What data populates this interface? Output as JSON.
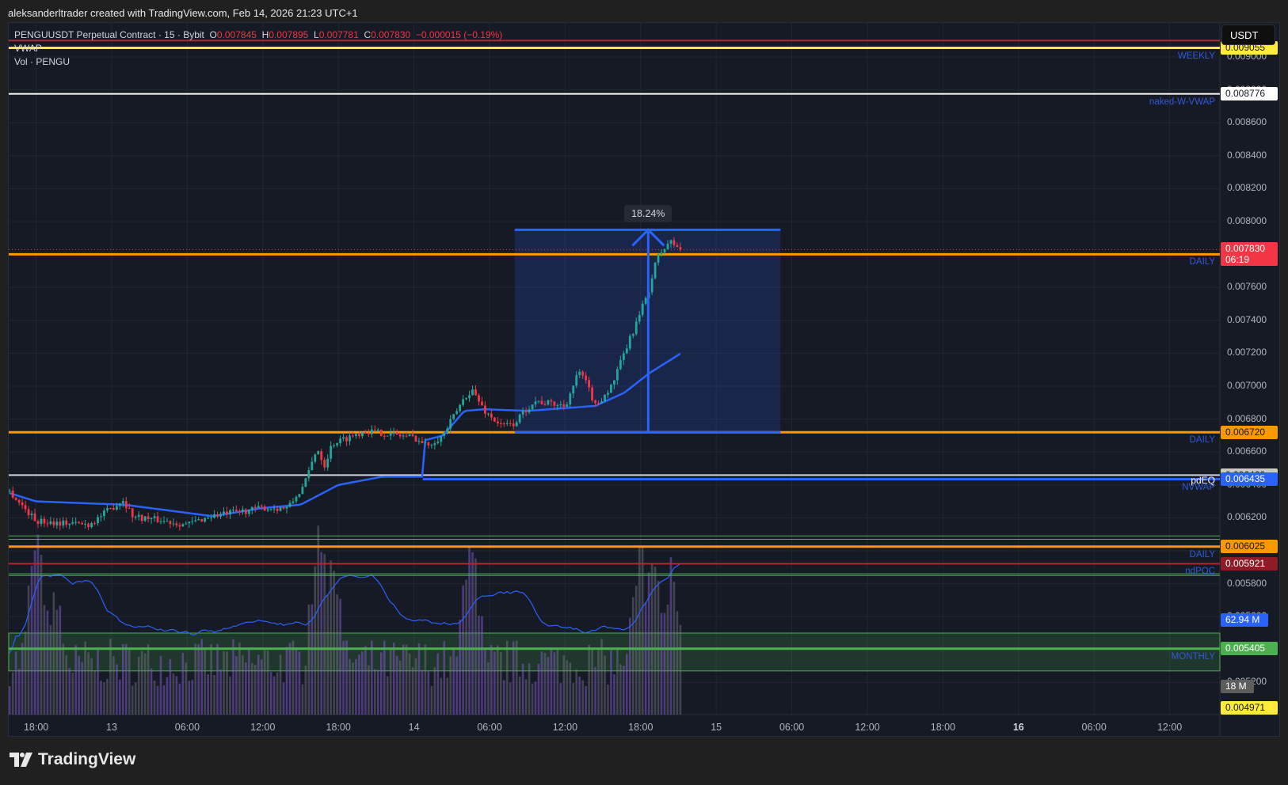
{
  "credit": "aleksanderltrader created with TradingView.com, Feb 14, 2026 21:23 UTC+1",
  "legend": {
    "symbol": "PENGUUSDT Perpetual Contract · 15 · Bybit",
    "o_label": "O",
    "o": "0.007845",
    "h_label": "H",
    "h": "0.007895",
    "l_label": "L",
    "l": "0.007781",
    "c_label": "C",
    "c": "0.007830",
    "change": "−0.000015 (−0.19%)",
    "vwap": "VWAP",
    "vol": "Vol · PENGU"
  },
  "currency": "USDT",
  "logo_text": "TradingView",
  "colors": {
    "up": "#26a69a",
    "down": "#f23645",
    "orange": "#ff9800",
    "blue": "#2962ff",
    "yellow": "#ffeb3b",
    "green": "#4caf50",
    "red": "#b22833",
    "bg": "#161a25"
  },
  "chart_data": {
    "type": "candlestick",
    "title": "PENGUUSDT Perpetual Contract · 15 · Bybit",
    "time_unit": "hours since Feb 12 18:00",
    "ylim": [
      0.00497,
      0.00914
    ],
    "y_ticks": [
      "0.009000",
      "0.008800",
      "0.008600",
      "0.008400",
      "0.008200",
      "0.008000",
      "0.007800",
      "0.007600",
      "0.007400",
      "0.007200",
      "0.007000",
      "0.006800",
      "0.006600",
      "0.006400",
      "0.006200",
      "0.006000",
      "0.005800",
      "0.005600",
      "0.005400",
      "0.005200"
    ],
    "x_ticks": [
      {
        "t": 0,
        "label": "18:00"
      },
      {
        "t": 6,
        "label": "13"
      },
      {
        "t": 12,
        "label": "06:00"
      },
      {
        "t": 18,
        "label": "12:00"
      },
      {
        "t": 24,
        "label": "18:00"
      },
      {
        "t": 30,
        "label": "14"
      },
      {
        "t": 36,
        "label": "06:00"
      },
      {
        "t": 42,
        "label": "12:00"
      },
      {
        "t": 48,
        "label": "18:00"
      },
      {
        "t": 54,
        "label": "15"
      },
      {
        "t": 60,
        "label": "06:00"
      },
      {
        "t": 66,
        "label": "12:00"
      },
      {
        "t": 72,
        "label": "18:00"
      },
      {
        "t": 78,
        "label": "16",
        "bold": true
      },
      {
        "t": 84,
        "label": "06:00"
      },
      {
        "t": 90,
        "label": "12:00"
      }
    ],
    "price_path": [
      [
        -2.1,
        0.00636
      ],
      [
        0,
        0.00618
      ],
      [
        4.2,
        0.00616
      ],
      [
        6.9,
        0.00631
      ],
      [
        7.7,
        0.00621
      ],
      [
        12,
        0.00616
      ],
      [
        13.8,
        0.00621
      ],
      [
        18,
        0.00626
      ],
      [
        20,
        0.00626
      ],
      [
        21.3,
        0.0064
      ],
      [
        22.3,
        0.00663
      ],
      [
        22.9,
        0.00652
      ],
      [
        23.5,
        0.00665
      ],
      [
        26.1,
        0.00673
      ],
      [
        30,
        0.00669
      ],
      [
        31,
        0.00664
      ],
      [
        32.3,
        0.0067
      ],
      [
        34,
        0.00693
      ],
      [
        34.6,
        0.00698
      ],
      [
        35.6,
        0.00685
      ],
      [
        36.9,
        0.00676
      ],
      [
        37.9,
        0.00677
      ],
      [
        39.5,
        0.00691
      ],
      [
        42,
        0.00688
      ],
      [
        43.1,
        0.00709
      ],
      [
        43.8,
        0.007
      ],
      [
        44.4,
        0.00688
      ],
      [
        45.7,
        0.007
      ],
      [
        46.7,
        0.0072
      ],
      [
        48,
        0.00745
      ],
      [
        48.7,
        0.0076
      ],
      [
        49.3,
        0.00778
      ],
      [
        50.3,
        0.00788
      ],
      [
        51.2,
        0.00783
      ]
    ],
    "vwap_path": [
      [
        -2.1,
        0.00635
      ],
      [
        0,
        0.0063
      ],
      [
        7,
        0.00628
      ],
      [
        14,
        0.00621
      ],
      [
        18,
        0.00626
      ],
      [
        21,
        0.00628
      ],
      [
        24,
        0.0064
      ],
      [
        27.5,
        0.00645
      ],
      [
        30.7,
        0.00645
      ],
      [
        30.8,
        0.00667
      ],
      [
        32.3,
        0.0067
      ],
      [
        34,
        0.00685
      ],
      [
        35.6,
        0.00686
      ],
      [
        39,
        0.00685
      ],
      [
        44.4,
        0.00688
      ],
      [
        46.7,
        0.00696
      ],
      [
        48.7,
        0.00708
      ],
      [
        51.2,
        0.0072
      ]
    ],
    "volume_spikes": [
      [
        0,
        0.9
      ],
      [
        1.5,
        0.6
      ],
      [
        22.5,
        0.9
      ],
      [
        23.5,
        0.75
      ],
      [
        34.5,
        0.9
      ],
      [
        48,
        0.8
      ],
      [
        49,
        0.75
      ],
      [
        50.5,
        0.7
      ]
    ],
    "levels": [
      {
        "price": 0.0091,
        "color": "#b22833",
        "width": 2,
        "tag": "",
        "label": ""
      },
      {
        "price": 0.009055,
        "color": "#ffeb3b",
        "width": 3,
        "tag": "WEEKLY",
        "label": "0.009055",
        "label_bg": "#ffeb3b",
        "label_fg": "#131722"
      },
      {
        "price": 0.008776,
        "color": "#ffffff",
        "width": 2,
        "tag": "naked-W-VWAP",
        "label": "0.008776",
        "label_bg": "#ffffff",
        "label_fg": "#131722"
      },
      {
        "price": 0.007801,
        "color": "#ff9800",
        "width": 3,
        "tag": "DAILY",
        "label": "0.007801",
        "label_bg": "#ff9800",
        "label_fg": "#131722"
      },
      {
        "price": 0.00672,
        "color": "#ff9800",
        "width": 3,
        "tag": "DAILY",
        "label": "0.006720",
        "label_bg": "#ff9800",
        "label_fg": "#131722"
      },
      {
        "price": 0.00646,
        "color": "#d1d4dc",
        "width": 2,
        "tag": "pdEQ",
        "label": "0.006460",
        "label_bg": "#c8c8c8",
        "label_fg": "#131722"
      },
      {
        "price": 0.006435,
        "color": "#2962ff",
        "width": 3,
        "tag": "NVWAP",
        "label": "0.006435",
        "label_bg": "#2962ff",
        "label_fg": "#ffffff",
        "from_t": 30.7
      },
      {
        "price": 0.00609,
        "color": "#4caf50",
        "width": 1,
        "tag": "",
        "label": ""
      },
      {
        "price": 0.00607,
        "color": "#4caf50",
        "width": 1,
        "tag": "",
        "label": ""
      },
      {
        "price": 0.006025,
        "color": "#ff9800",
        "width": 3,
        "tag": "DAILY",
        "label": "0.006025",
        "label_bg": "#ff9800",
        "label_fg": "#131722"
      },
      {
        "price": 0.005921,
        "color": "#b22833",
        "width": 2,
        "tag": "ndPOC",
        "label": "0.005921",
        "label_bg": "#8e1c26",
        "label_fg": "#ffffff"
      },
      {
        "price": 0.00586,
        "color": "#4caf50",
        "width": 1,
        "tag": "",
        "label": ""
      },
      {
        "price": 0.00585,
        "color": "#4caf50",
        "width": 1,
        "tag": "",
        "label": ""
      },
      {
        "price": 0.005405,
        "color": "#4caf50",
        "width": 3,
        "tag": "MONTHLY",
        "label": "0.005405",
        "label_bg": "#4caf50",
        "label_fg": "#ffffff",
        "band": [
          0.0055,
          0.00527
        ]
      }
    ],
    "current_price": {
      "label": "0.007830",
      "countdown": "06:19",
      "price": 0.00783
    },
    "offscreen_label": "0.004971",
    "volume_labels": {
      "ma": "62.94 M",
      "vol": "18 M"
    },
    "measure": {
      "t_start": 38,
      "t_end": 59.1,
      "t_arrow": 48.6,
      "low": 0.00672,
      "high": 0.00795,
      "label": "18.24%"
    }
  }
}
